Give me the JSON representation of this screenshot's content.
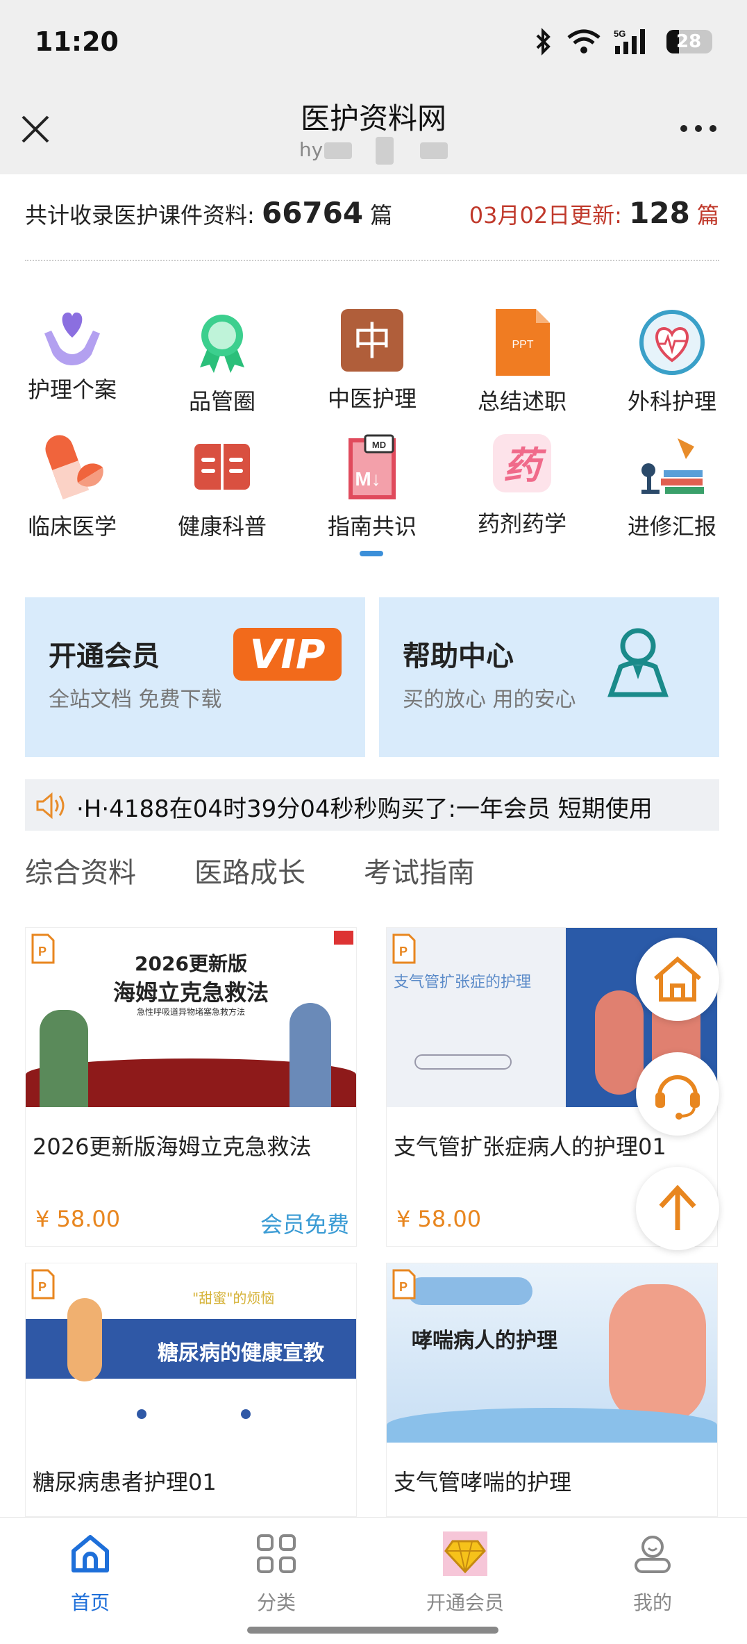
{
  "status": {
    "time": "11:20",
    "battery": "28",
    "network": "5G"
  },
  "header": {
    "title": "医护资料网",
    "subtitle": "hy"
  },
  "stats": {
    "prefix": "共计收录医护课件资料:",
    "total": "66764",
    "unit": "篇",
    "update_prefix": "03月02日更新:",
    "update_count": "128",
    "update_unit": "篇"
  },
  "categories": [
    {
      "label": "护理个案",
      "icon": "heart-hands-icon",
      "color": "#8b6fe0"
    },
    {
      "label": "品管圈",
      "icon": "award-icon",
      "color": "#3ccf8e"
    },
    {
      "label": "中医护理",
      "icon": "zhong-icon",
      "color": "#b05e3a"
    },
    {
      "label": "总结述职",
      "icon": "ppt-icon",
      "color": "#f07c22"
    },
    {
      "label": "外科护理",
      "icon": "heart-pulse-icon",
      "color": "#3aa0c8"
    },
    {
      "label": "临床医学",
      "icon": "pill-icon",
      "color": "#f0643c"
    },
    {
      "label": "健康科普",
      "icon": "book-icon",
      "color": "#d95040"
    },
    {
      "label": "指南共识",
      "icon": "markdown-icon",
      "color": "#e04a5c"
    },
    {
      "label": "药剂药学",
      "icon": "yao-icon",
      "color": "#f06a8a"
    },
    {
      "label": "进修汇报",
      "icon": "study-lamp-icon",
      "color": "#e88c2a"
    }
  ],
  "promos": [
    {
      "title": "开通会员",
      "sub": "全站文档 免费下载",
      "badge": "VIP"
    },
    {
      "title": "帮助中心",
      "sub": "买的放心 用的安心"
    }
  ],
  "notice": "·H·4188在04时39分04秒秒购买了:一年会员 短期使用",
  "tabs": [
    "综合资料",
    "医路成长",
    "考试指南"
  ],
  "cards": [
    {
      "name": "2026更新版海姆立克急救法",
      "price": "¥ 58.00",
      "free": "会员免费",
      "img_title1": "2026更新版",
      "img_title2": "海姆立克急救法",
      "img_sub": "急性呼吸道异物堵塞急救方法"
    },
    {
      "name": "支气管扩张症病人的护理01",
      "price": "¥ 58.00",
      "free": "会",
      "img_title1": "支气管扩张症的护理"
    },
    {
      "name": "糖尿病患者护理01",
      "img_title1": "糖尿病的健康宣教",
      "img_tag": "\"甜蜜\"的烦恼"
    },
    {
      "name": "支气管哮喘的护理",
      "img_title1": "哮喘病人的护理"
    }
  ],
  "nav": [
    {
      "label": "首页",
      "icon": "home-icon",
      "active": true
    },
    {
      "label": "分类",
      "icon": "grid-icon",
      "active": false
    },
    {
      "label": "开通会员",
      "icon": "diamond-icon",
      "active": false
    },
    {
      "label": "我的",
      "icon": "user-icon",
      "active": false
    }
  ],
  "colors": {
    "accent": "#3b8fd9",
    "price": "#e8861f",
    "vip": "#f26a1b",
    "update": "#c0392b"
  }
}
